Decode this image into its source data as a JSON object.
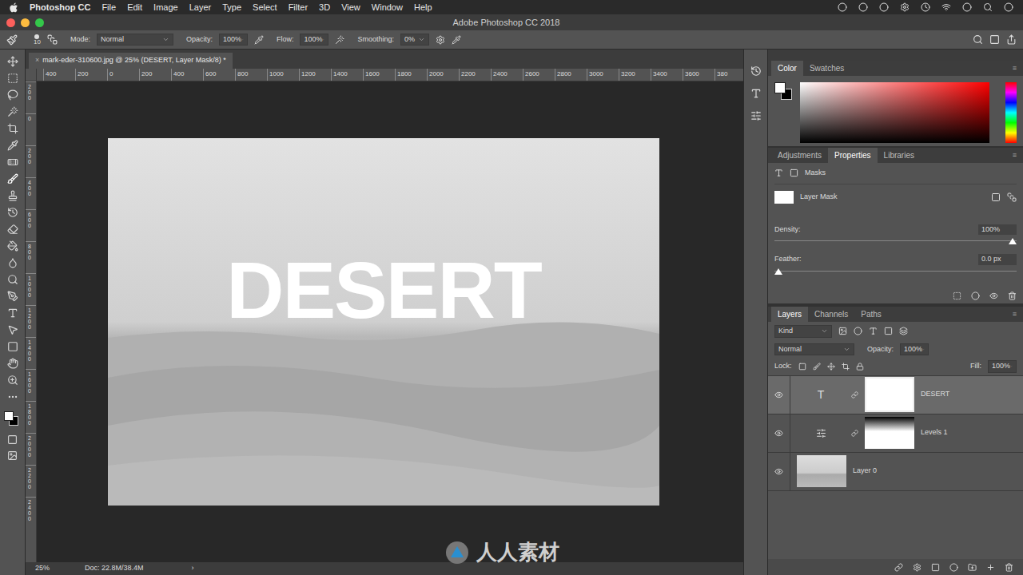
{
  "menubar": {
    "app": "Photoshop CC",
    "items": [
      "File",
      "Edit",
      "Image",
      "Layer",
      "Type",
      "Select",
      "Filter",
      "3D",
      "View",
      "Window",
      "Help"
    ]
  },
  "window": {
    "title": "Adobe Photoshop CC 2018"
  },
  "options": {
    "brush_size": "10",
    "mode_label": "Mode:",
    "mode": "Normal",
    "opacity_label": "Opacity:",
    "opacity": "100%",
    "flow_label": "Flow:",
    "flow": "100%",
    "smoothing_label": "Smoothing:",
    "smoothing": "0%"
  },
  "document": {
    "tab": "mark-eder-310600.jpg @ 25% (DESERT, Layer Mask/8) *",
    "ruler_h": [
      "400",
      "200",
      "0",
      "200",
      "400",
      "600",
      "800",
      "1000",
      "1200",
      "1400",
      "1600",
      "1800",
      "2000",
      "2200",
      "2400",
      "2600",
      "2800",
      "3000",
      "3200",
      "3400",
      "3600",
      "380"
    ],
    "ruler_v": [
      "200",
      "0",
      "200",
      "400",
      "600",
      "800",
      "1000",
      "1200",
      "1400",
      "1600",
      "1800",
      "2000",
      "2200",
      "2400"
    ],
    "canvas_text": "DESERT",
    "watermark": "人人素材"
  },
  "status_bar": {
    "zoom": "25%",
    "doc": "Doc: 22.8M/38.4M",
    "arrow": "›"
  },
  "color_panel": {
    "tabs": [
      {
        "label": "Color",
        "selected": true
      },
      {
        "label": "Swatches",
        "selected": false
      }
    ]
  },
  "properties_panel": {
    "tabs": [
      {
        "label": "Adjustments",
        "selected": false
      },
      {
        "label": "Properties",
        "selected": true
      },
      {
        "label": "Libraries",
        "selected": false
      }
    ],
    "section": "Masks",
    "mask_label": "Layer Mask",
    "sliders": [
      {
        "label": "Density:",
        "value": "100%",
        "level": 1
      },
      {
        "label": "Feather:",
        "value": "0.0 px",
        "level": 0
      }
    ]
  },
  "layers_panel": {
    "tabs": [
      {
        "label": "Layers",
        "selected": true
      },
      {
        "label": "Channels",
        "selected": false
      },
      {
        "label": "Paths",
        "selected": false
      }
    ],
    "filter": "Kind",
    "blend": "Normal",
    "opacity_label": "Opacity:",
    "opacity": "100%",
    "lock_label": "Lock:",
    "fill_label": "Fill:",
    "fill": "100%",
    "layers": [
      {
        "name": "DESERT",
        "kind": "text",
        "icon": "T",
        "selected": true,
        "visible": true
      },
      {
        "name": "Levels 1",
        "kind": "adjustment",
        "selected": false,
        "visible": true
      },
      {
        "name": "Layer 0",
        "kind": "image",
        "selected": false,
        "visible": true
      }
    ]
  }
}
